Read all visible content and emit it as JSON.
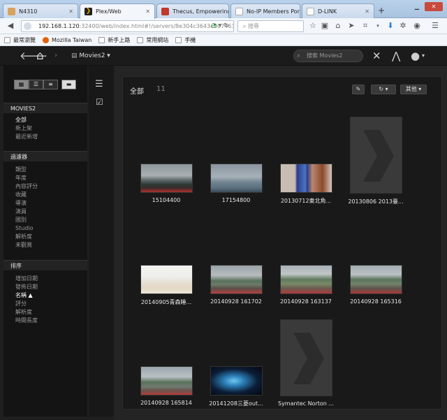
{
  "browser": {
    "tabs": [
      {
        "label": "N4310",
        "icon": "user-icon",
        "color": "#d9a25f"
      },
      {
        "label": "Plex/Web",
        "icon": "plex-icon",
        "color": "#e5a00d",
        "active": true
      },
      {
        "label": "Thecus, Empowering...",
        "icon": "thecus-icon",
        "color": "#c0392b"
      },
      {
        "label": "No-IP Members Portal: ...",
        "icon": "page-icon",
        "color": "#ffffff"
      },
      {
        "label": "D-LINK",
        "icon": "page-icon",
        "color": "#ffffff"
      }
    ],
    "url_main": "192.168.1.120",
    "url_rest": ":32400/web/index.html#!/servers/8e304c3643e00746178e73",
    "search_placeholder": "搜尋",
    "bookmarks": [
      "最常瀏覽",
      "Mozilla Taiwan",
      "新手上路",
      "常用網站",
      "手機"
    ]
  },
  "plex": {
    "library_title": "Movies2",
    "search_placeholder": "搜索 Movies2",
    "sidebar": {
      "library_header": "MOVIES2",
      "library_items": [
        "全部",
        "新上架",
        "最近新增"
      ],
      "filter_header": "過濾器",
      "filter_items": [
        "類型",
        "年度",
        "內容評分",
        "收藏",
        "導演",
        "演員",
        "國別",
        "Studio",
        "解析度",
        "未觀賞"
      ],
      "sort_header": "排序",
      "sort_items": [
        "增加日期",
        "發佈日期",
        "名稱 ▲",
        "評分",
        "解析度",
        "時間長度"
      ]
    },
    "content": {
      "title": "全部",
      "count": "11",
      "more_label": "其他 ▾",
      "items": [
        {
          "title": "15104400",
          "kind": "landscape",
          "scene": "crowd-mountain"
        },
        {
          "title": "17154800",
          "kind": "landscape",
          "scene": "crowd-lake"
        },
        {
          "title": "20130712東北角...",
          "kind": "landscape",
          "scene": "tv-room"
        },
        {
          "title": "20130806 2013臺...",
          "kind": "poster",
          "scene": "placeholder"
        },
        {
          "title": "20140905青森睡...",
          "kind": "landscape",
          "scene": "festival-bright"
        },
        {
          "title": "20140928 161702",
          "kind": "landscape",
          "scene": "crowd-mountain"
        },
        {
          "title": "20140928 163137",
          "kind": "landscape",
          "scene": "crowd-mountain"
        },
        {
          "title": "20140928 165316",
          "kind": "landscape",
          "scene": "crowd-mountain"
        },
        {
          "title": "20140928 165814",
          "kind": "landscape",
          "scene": "crowd-mountain"
        },
        {
          "title": "20141208三菱out...",
          "kind": "landscape",
          "scene": "stage-blue"
        },
        {
          "title": "Symantec Norton ...",
          "kind": "poster",
          "scene": "placeholder"
        }
      ]
    }
  }
}
